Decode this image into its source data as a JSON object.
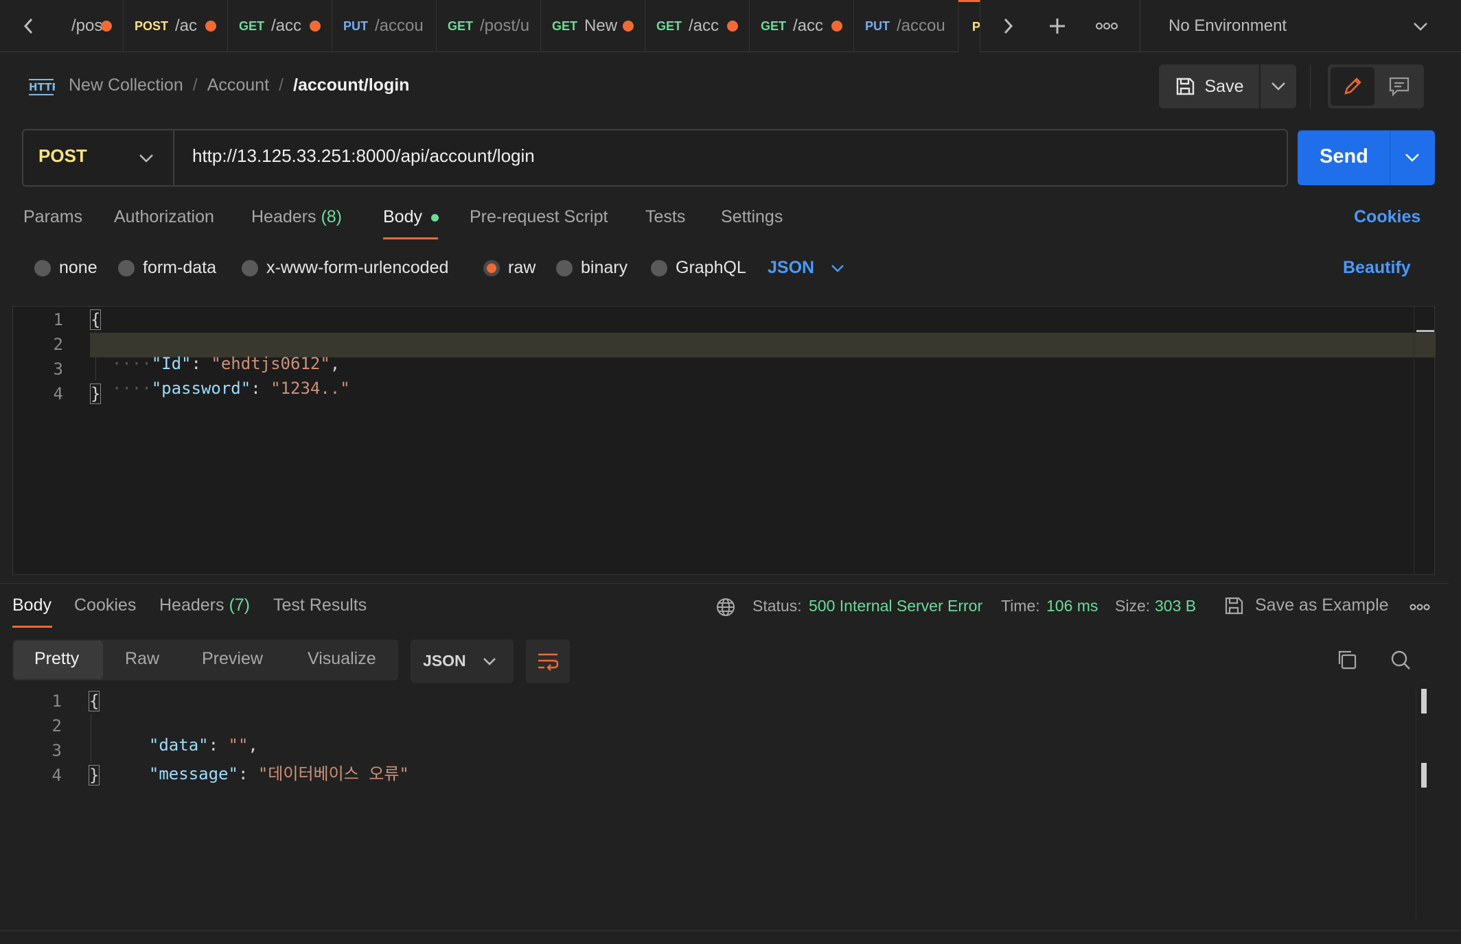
{
  "tabs": [
    {
      "method": "",
      "path": "/pos",
      "dirty": true
    },
    {
      "method": "POST",
      "path": "/ac",
      "dirty": true
    },
    {
      "method": "GET",
      "path": "/acc",
      "dirty": true
    },
    {
      "method": "PUT",
      "path": "/accou",
      "dirty": false
    },
    {
      "method": "GET",
      "path": "/post/u",
      "dirty": false
    },
    {
      "method": "GET",
      "path": "New",
      "dirty": true
    },
    {
      "method": "GET",
      "path": "/acc",
      "dirty": true
    },
    {
      "method": "GET",
      "path": "/acc",
      "dirty": true
    },
    {
      "method": "PUT",
      "path": "/accou",
      "dirty": false
    },
    {
      "method": "P",
      "path": "",
      "dirty": false
    }
  ],
  "environment": "No Environment",
  "breadcrumb": {
    "icon_text": "HTTP",
    "collection": "New Collection",
    "folder": "Account",
    "request": "/account/login",
    "sep": "/"
  },
  "save_label": "Save",
  "request": {
    "method": "POST",
    "url": "http://13.125.33.251:8000/api/account/login",
    "send_label": "Send"
  },
  "request_tabs": {
    "params": "Params",
    "authorization": "Authorization",
    "headers": "Headers",
    "headers_count": "(8)",
    "body": "Body",
    "pre_request": "Pre-request Script",
    "tests": "Tests",
    "settings": "Settings",
    "cookies": "Cookies"
  },
  "body_types": {
    "none": "none",
    "form_data": "form-data",
    "urlencoded": "x-www-form-urlencoded",
    "raw": "raw",
    "binary": "binary",
    "graphql": "GraphQL",
    "format": "JSON",
    "beautify": "Beautify"
  },
  "request_body": {
    "lines": [
      "1",
      "2",
      "3",
      "4"
    ],
    "open": "{",
    "close": "}",
    "key1": "\"Id\"",
    "val1": "\"ehdtjs0612\"",
    "key2": "\"password\"",
    "val2": "\"1234..\""
  },
  "response_tabs": {
    "body": "Body",
    "cookies": "Cookies",
    "headers": "Headers",
    "headers_count": "(7)",
    "test_results": "Test Results"
  },
  "status": {
    "status_label": "Status:",
    "status_value": "500 Internal Server Error",
    "time_label": "Time:",
    "time_value": "106 ms",
    "size_label": "Size:",
    "size_value": "303 B",
    "save_example": "Save as Example"
  },
  "view_modes": {
    "pretty": "Pretty",
    "raw": "Raw",
    "preview": "Preview",
    "visualize": "Visualize",
    "format": "JSON"
  },
  "response_body": {
    "lines": [
      "1",
      "2",
      "3",
      "4"
    ],
    "open": "{",
    "close": "}",
    "key1": "\"data\"",
    "val1": "\"\"",
    "key2": "\"message\"",
    "val2": "\"데이터베이스 오류\""
  },
  "colors": {
    "accent": "#f06a35",
    "send": "#1f6feb",
    "link": "#4a9aff",
    "success": "#6bdd9a"
  }
}
